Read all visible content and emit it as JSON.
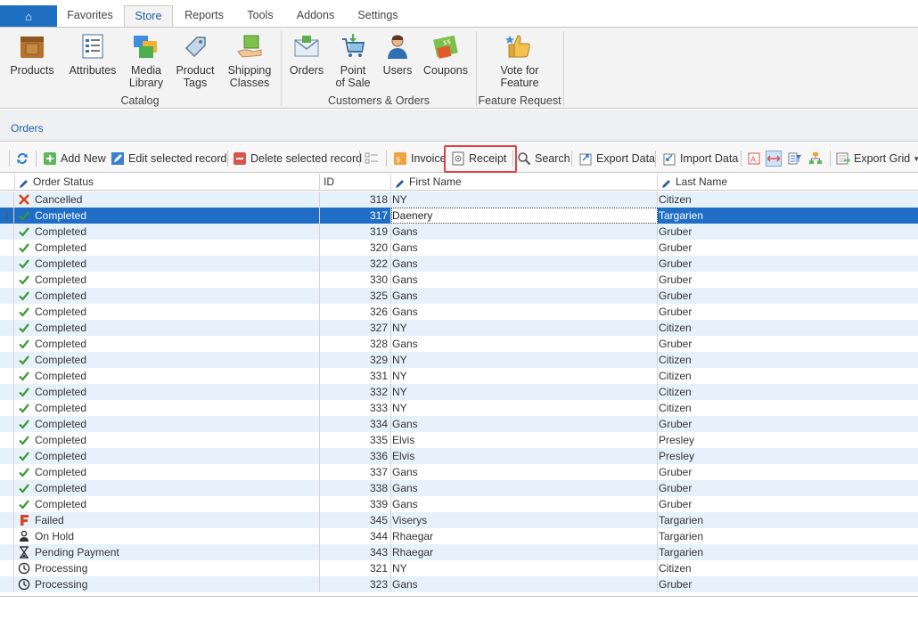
{
  "app_button": {
    "glyph": "⌂"
  },
  "tabs": [
    {
      "label": "Favorites",
      "active": false
    },
    {
      "label": "Store",
      "active": true
    },
    {
      "label": "Reports",
      "active": false
    },
    {
      "label": "Tools",
      "active": false
    },
    {
      "label": "Addons",
      "active": false
    },
    {
      "label": "Settings",
      "active": false
    }
  ],
  "ribbon": {
    "buttons": [
      {
        "line1": "Products",
        "line2": "",
        "icon": "box-icon"
      },
      {
        "line1": "Attributes",
        "line2": "",
        "icon": "attributes-list-icon"
      },
      {
        "line1": "Media",
        "line2": "Library",
        "icon": "media-library-icon"
      },
      {
        "line1": "Product",
        "line2": "Tags",
        "icon": "tag-icon"
      },
      {
        "line1": "Shipping",
        "line2": "Classes",
        "icon": "shipping-hand-icon"
      },
      {
        "line1": "Orders",
        "line2": "",
        "icon": "orders-envelope-icon"
      },
      {
        "line1": "Point",
        "line2": "of Sale",
        "icon": "cart-icon"
      },
      {
        "line1": "Users",
        "line2": "",
        "icon": "user-icon"
      },
      {
        "line1": "Coupons",
        "line2": "",
        "icon": "coupon-icon"
      },
      {
        "line1": "Vote for",
        "line2": "Feature",
        "icon": "thumbs-up-icon"
      }
    ],
    "groups": [
      {
        "label": "Catalog"
      },
      {
        "label": "Customers & Orders"
      },
      {
        "label": "Feature Request"
      }
    ]
  },
  "breadcrumb": {
    "label": "Orders"
  },
  "toolbar": {
    "add_new": "Add New",
    "edit": "Edit selected record",
    "delete": "Delete selected record",
    "invoice": "Invoice",
    "receipt": "Receipt",
    "search": "Search",
    "export_data": "Export Data",
    "import_data": "Import Data",
    "export_grid": "Export Grid"
  },
  "grid": {
    "columns": {
      "status": "Order Status",
      "id": "ID",
      "first": "First Name",
      "last": "Last Name"
    },
    "rows": [
      {
        "status": "Cancelled",
        "id": "318",
        "first": "NY",
        "last": "Citizen",
        "icon": "cancelled-x-icon"
      },
      {
        "status": "Completed",
        "id": "317",
        "first": "Daenery",
        "last": "Targarien",
        "icon": "check-icon",
        "selected": true
      },
      {
        "status": "Completed",
        "id": "319",
        "first": "Gans",
        "last": "Gruber",
        "icon": "check-icon"
      },
      {
        "status": "Completed",
        "id": "320",
        "first": "Gans",
        "last": "Gruber",
        "icon": "check-icon"
      },
      {
        "status": "Completed",
        "id": "322",
        "first": "Gans",
        "last": "Gruber",
        "icon": "check-icon"
      },
      {
        "status": "Completed",
        "id": "330",
        "first": "Gans",
        "last": "Gruber",
        "icon": "check-icon"
      },
      {
        "status": "Completed",
        "id": "325",
        "first": "Gans",
        "last": "Gruber",
        "icon": "check-icon"
      },
      {
        "status": "Completed",
        "id": "326",
        "first": "Gans",
        "last": "Gruber",
        "icon": "check-icon"
      },
      {
        "status": "Completed",
        "id": "327",
        "first": "NY",
        "last": "Citizen",
        "icon": "check-icon"
      },
      {
        "status": "Completed",
        "id": "328",
        "first": "Gans",
        "last": "Gruber",
        "icon": "check-icon"
      },
      {
        "status": "Completed",
        "id": "329",
        "first": "NY",
        "last": "Citizen",
        "icon": "check-icon"
      },
      {
        "status": "Completed",
        "id": "331",
        "first": "NY",
        "last": "Citizen",
        "icon": "check-icon"
      },
      {
        "status": "Completed",
        "id": "332",
        "first": "NY",
        "last": "Citizen",
        "icon": "check-icon"
      },
      {
        "status": "Completed",
        "id": "333",
        "first": "NY",
        "last": "Citizen",
        "icon": "check-icon"
      },
      {
        "status": "Completed",
        "id": "334",
        "first": "Gans",
        "last": "Gruber",
        "icon": "check-icon"
      },
      {
        "status": "Completed",
        "id": "335",
        "first": "Elvis",
        "last": "Presley",
        "icon": "check-icon"
      },
      {
        "status": "Completed",
        "id": "336",
        "first": "Elvis",
        "last": "Presley",
        "icon": "check-icon"
      },
      {
        "status": "Completed",
        "id": "337",
        "first": "Gans",
        "last": "Gruber",
        "icon": "check-icon"
      },
      {
        "status": "Completed",
        "id": "338",
        "first": "Gans",
        "last": "Gruber",
        "icon": "check-icon"
      },
      {
        "status": "Completed",
        "id": "339",
        "first": "Gans",
        "last": "Gruber",
        "icon": "check-icon"
      },
      {
        "status": "Failed",
        "id": "345",
        "first": "Viserys",
        "last": "Targarien",
        "icon": "failed-f-icon"
      },
      {
        "status": "On Hold",
        "id": "344",
        "first": "Rhaegar",
        "last": "Targarien",
        "icon": "on-hold-person-icon"
      },
      {
        "status": "Pending Payment",
        "id": "343",
        "first": "Rhaegar",
        "last": "Targarien",
        "icon": "hourglass-icon"
      },
      {
        "status": "Processing",
        "id": "321",
        "first": "NY",
        "last": "Citizen",
        "icon": "clock-icon"
      },
      {
        "status": "Processing",
        "id": "323",
        "first": "Gans",
        "last": "Gruber",
        "icon": "clock-icon"
      }
    ]
  },
  "colors": {
    "accent": "#1e6fc2",
    "selected_row": "#1f6dc4",
    "alt_row": "#e6f1fb",
    "highlight_box": "#e0413f",
    "check_green": "#3a9a2e",
    "cancel_red": "#d9431e"
  }
}
